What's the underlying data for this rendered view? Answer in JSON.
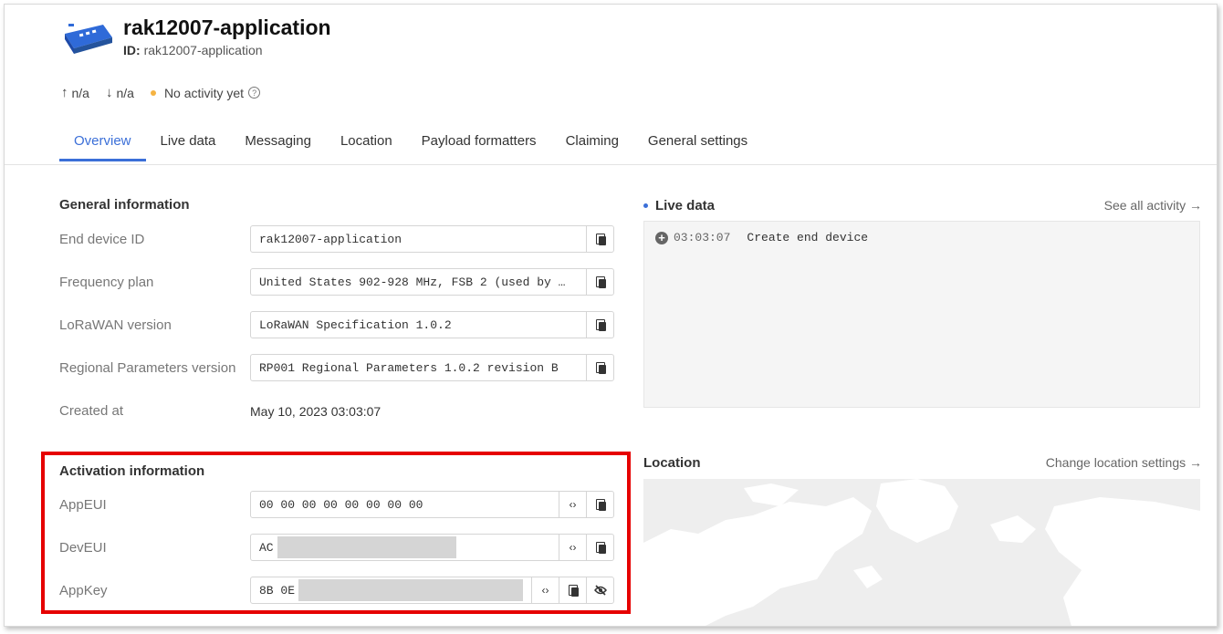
{
  "header": {
    "title": "rak12007-application",
    "id_label": "ID:",
    "id_value": "rak12007-application",
    "uplink": "n/a",
    "downlink": "n/a",
    "activity": "No activity yet",
    "activity_dot_color": "#f5b342"
  },
  "tabs": [
    {
      "label": "Overview",
      "active": true
    },
    {
      "label": "Live data"
    },
    {
      "label": "Messaging"
    },
    {
      "label": "Location"
    },
    {
      "label": "Payload formatters"
    },
    {
      "label": "Claiming"
    },
    {
      "label": "General settings"
    }
  ],
  "general": {
    "heading": "General information",
    "end_device_id_label": "End device ID",
    "end_device_id": "rak12007-application",
    "frequency_plan_label": "Frequency plan",
    "frequency_plan": "United States 902-928 MHz, FSB 2 (used by …",
    "lorawan_version_label": "LoRaWAN version",
    "lorawan_version": "LoRaWAN Specification 1.0.2",
    "regional_label": "Regional Parameters version",
    "regional": "RP001 Regional Parameters 1.0.2 revision B",
    "created_label": "Created at",
    "created": "May 10, 2023 03:03:07"
  },
  "activation": {
    "heading": "Activation information",
    "appeui_label": "AppEUI",
    "appeui": "00 00 00 00 00 00 00 00",
    "deveui_label": "DevEUI",
    "deveui_prefix": "AC",
    "appkey_label": "AppKey",
    "appkey_prefix": "8B 0E"
  },
  "live": {
    "heading": "Live data",
    "see_all": "See all activity →",
    "event_time": "03:03:07",
    "event_text": "Create end device"
  },
  "location": {
    "heading": "Location",
    "change": "Change location settings →"
  },
  "colors": {
    "accent": "#3b6fd8",
    "highlight": "#e60000"
  }
}
